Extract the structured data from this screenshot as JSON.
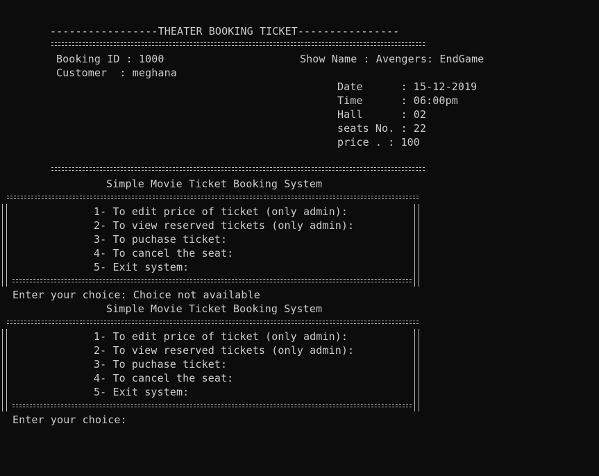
{
  "ticket": {
    "header": "-----------------THEATER BOOKING TICKET----------------",
    "booking_id": "Booking ID : 1000",
    "customer": "Customer  : meghana",
    "show_name": "Show Name : Avengers: EndGame",
    "date": "Date      : 15-12-2019",
    "time": "Time      : 06:00pm",
    "hall": "Hall      : 02",
    "seats": "seats No. : 22",
    "price": "price . : 100"
  },
  "menu_block_1": {
    "title": "Simple Movie Ticket Booking System",
    "items": [
      "1- To edit price of ticket (only admin):",
      "2- To view reserved tickets (only admin):",
      "3- To puchase ticket:",
      "4- To cancel the seat:",
      "5- Exit system:"
    ],
    "prompt": "Enter your choice: Choice not available"
  },
  "menu_block_2": {
    "title": "Simple Movie Ticket Booking System",
    "items": [
      "1- To edit price of ticket (only admin):",
      "2- To view reserved tickets (only admin):",
      "3- To puchase ticket:",
      "4- To cancel the seat:",
      "5- Exit system:"
    ],
    "prompt": "Enter your choice:"
  }
}
